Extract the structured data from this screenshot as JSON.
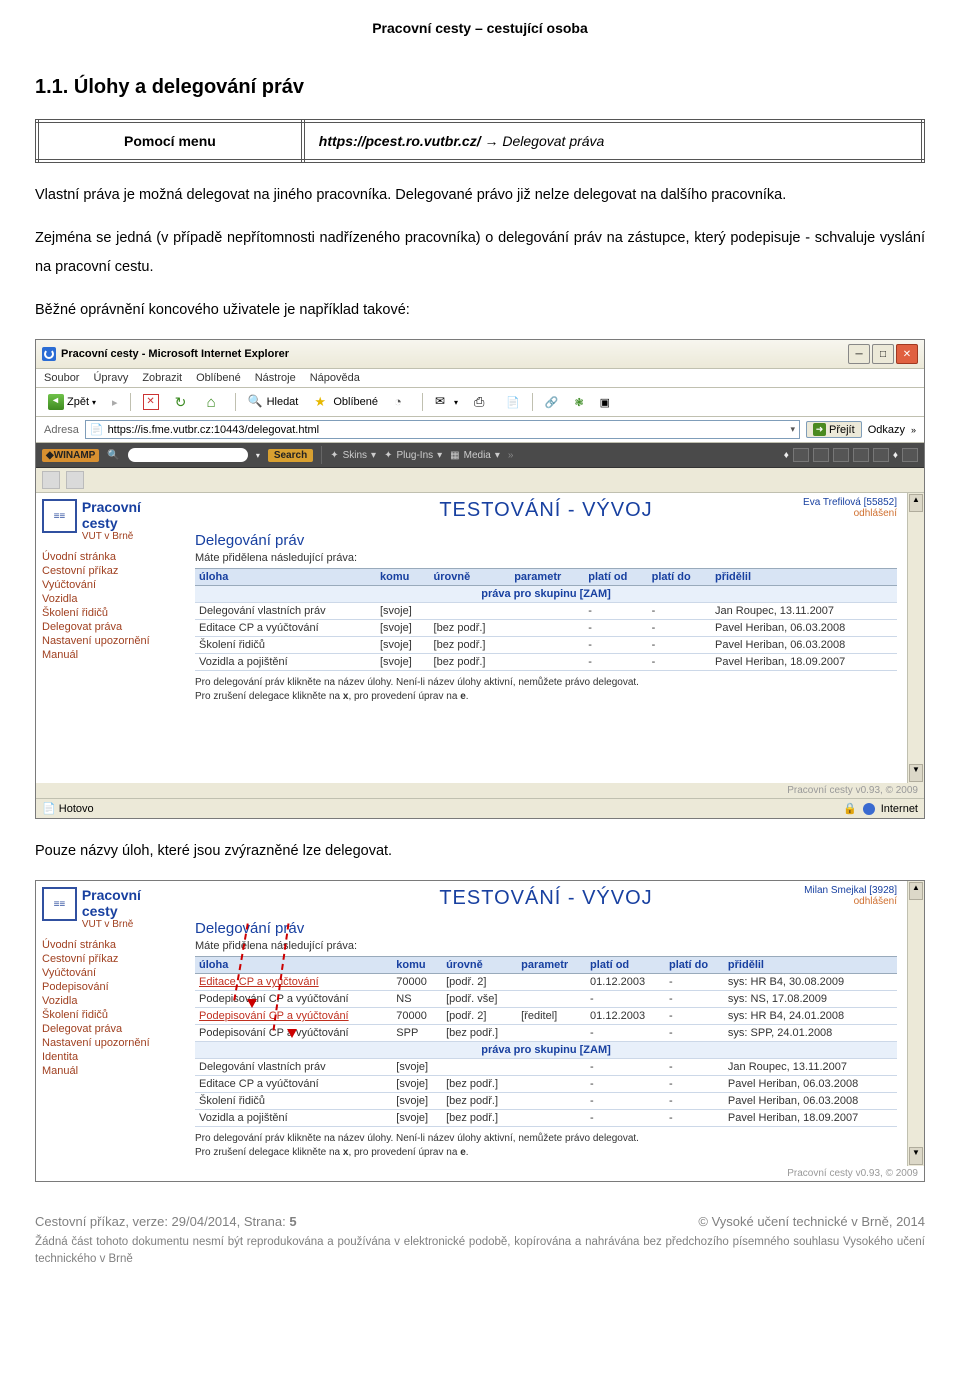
{
  "doc": {
    "header": "Pracovní cesty – cestující osoba",
    "section": "1.1.   Úlohy a delegování práv",
    "menu_label": "Pomocí menu",
    "menu_url": "https://pcest.ro.vutbr.cz/",
    "menu_arrow": " → ",
    "menu_action": "Delegovat práva",
    "p1": "Vlastní práva je možná delegovat na jiného pracovníka. Delegované právo již nelze delegovat na dalšího pracovníka.",
    "p2": "Zejména se jedná (v případě nepřítomnosti nadřízeného pracovníka) o delegování práv na zástupce, který podepisuje - schvaluje vyslání na pracovní cestu.",
    "p3": "Běžné oprávnění koncového uživatele je například takové:",
    "p4": "Pouze názvy úloh, které jsou zvýrazněné lze delegovat."
  },
  "ie": {
    "title": "Pracovní cesty - Microsoft Internet Explorer",
    "menus": [
      "Soubor",
      "Úpravy",
      "Zobrazit",
      "Oblíbené",
      "Nástroje",
      "Nápověda"
    ],
    "back": "Zpět",
    "search": "Hledat",
    "favorites": "Oblíbené",
    "addr_label": "Adresa",
    "addr_value": "https://is.fme.vutbr.cz:10443/delegovat.html",
    "go": "Přejít",
    "links": "Odkazy",
    "winamp": {
      "logo": "◆WINAMP",
      "search": "Search",
      "skins": "Skins",
      "plugins": "Plug-Ins",
      "media": "Media"
    },
    "status_left": "Hotovo",
    "status_right": "Internet"
  },
  "app": {
    "title": "Pracovní cesty",
    "subtitle": "VUT v Brně",
    "test_header": "TESTOVÁNÍ - VÝVOJ",
    "section_title": "Delegování práv",
    "intro": "Máte přidělena následující práva:",
    "columns": [
      "úloha",
      "komu",
      "úrovně",
      "parametr",
      "platí od",
      "platí do",
      "přidělil"
    ],
    "group_row": "práva pro skupinu [ZAM]",
    "hint1": "Pro delegování práv klikněte na název úlohy. Není-li název úlohy aktivní, nemůžete právo delegovat.",
    "hint2_a": "Pro zrušení delegace klikněte na ",
    "hint2_x": "x",
    "hint2_b": ", pro provedení úprav na ",
    "hint2_e": "e",
    "hint2_c": ".",
    "version": "Pracovní cesty v0.93, © 2009"
  },
  "user1": {
    "name": "Eva Trefilová [55852]",
    "logout": "odhlášení"
  },
  "nav1": [
    "Úvodní stránka",
    "Cestovní příkaz",
    "Vyúčtování",
    "Vozidla",
    "Školení řidičů",
    "Delegovat práva",
    "Nastavení upozornění",
    "Manuál"
  ],
  "rows1": [
    {
      "uloha": "Delegování vlastních práv",
      "komu": "[svoje]",
      "urovne": "",
      "param": "",
      "od": "-",
      "do": "-",
      "pridelil": "Jan Roupec, 13.11.2007"
    },
    {
      "uloha": "Editace CP a vyúčtování",
      "komu": "[svoje]",
      "urovne": "[bez podř.]",
      "param": "",
      "od": "-",
      "do": "-",
      "pridelil": "Pavel Heriban, 06.03.2008"
    },
    {
      "uloha": "Školení řidičů",
      "komu": "[svoje]",
      "urovne": "[bez podř.]",
      "param": "",
      "od": "-",
      "do": "-",
      "pridelil": "Pavel Heriban, 06.03.2008"
    },
    {
      "uloha": "Vozidla a pojištění",
      "komu": "[svoje]",
      "urovne": "[bez podř.]",
      "param": "",
      "od": "-",
      "do": "-",
      "pridelil": "Pavel Heriban, 18.09.2007"
    }
  ],
  "user2": {
    "name": "Milan Smejkal [3928]",
    "logout": "odhlášení"
  },
  "nav2": [
    "Úvodní stránka",
    "Cestovní příkaz",
    "Vyúčtování",
    "Podepisování",
    "Vozidla",
    "Školení řidičů",
    "Delegovat práva",
    "Nastavení upozornění",
    "Identita",
    "Manuál"
  ],
  "rows2a": [
    {
      "uloha": "Editace CP a vyúčtování",
      "komu": "70000",
      "urovne": "[podř. 2]",
      "param": "",
      "od": "01.12.2003",
      "do": "-",
      "pridelil": "sys: HR B4, 30.08.2009",
      "link": true
    },
    {
      "uloha": "Podepisování CP a vyúčtování",
      "komu": "NS",
      "urovne": "[podř. vše]",
      "param": "",
      "od": "-",
      "do": "-",
      "pridelil": "sys: NS, 17.08.2009",
      "link": false
    },
    {
      "uloha": "Podepisování CP a vyúčtování",
      "komu": "70000",
      "urovne": "[podř. 2]",
      "param": "[ředitel]",
      "od": "01.12.2003",
      "do": "-",
      "pridelil": "sys: HR B4, 24.01.2008",
      "link": true
    },
    {
      "uloha": "Podepisování CP a vyúčtování",
      "komu": "SPP",
      "urovne": "[bez podř.]",
      "param": "",
      "od": "-",
      "do": "-",
      "pridelil": "sys: SPP, 24.01.2008",
      "link": false
    }
  ],
  "rows2b": [
    {
      "uloha": "Delegování vlastních práv",
      "komu": "[svoje]",
      "urovne": "",
      "param": "",
      "od": "-",
      "do": "-",
      "pridelil": "Jan Roupec, 13.11.2007"
    },
    {
      "uloha": "Editace CP a vyúčtování",
      "komu": "[svoje]",
      "urovne": "[bez podř.]",
      "param": "",
      "od": "-",
      "do": "-",
      "pridelil": "Pavel Heriban, 06.03.2008"
    },
    {
      "uloha": "Školení řidičů",
      "komu": "[svoje]",
      "urovne": "[bez podř.]",
      "param": "",
      "od": "-",
      "do": "-",
      "pridelil": "Pavel Heriban, 06.03.2008"
    },
    {
      "uloha": "Vozidla a pojištění",
      "komu": "[svoje]",
      "urovne": "[bez podř.]",
      "param": "",
      "od": "-",
      "do": "-",
      "pridelil": "Pavel Heriban, 18.09.2007"
    }
  ],
  "footer": {
    "left_a": "Cestovní příkaz, verze: 29/04/2014, Strana: ",
    "left_b": "5",
    "right": "© Vysoké učení technické v Brně, 2014",
    "rest": "Žádná část tohoto dokumentu nesmí být reprodukována a používána v elektronické podobě, kopírována a nahrávána bez předchozího písemného souhlasu Vysokého učení technického v Brně"
  }
}
